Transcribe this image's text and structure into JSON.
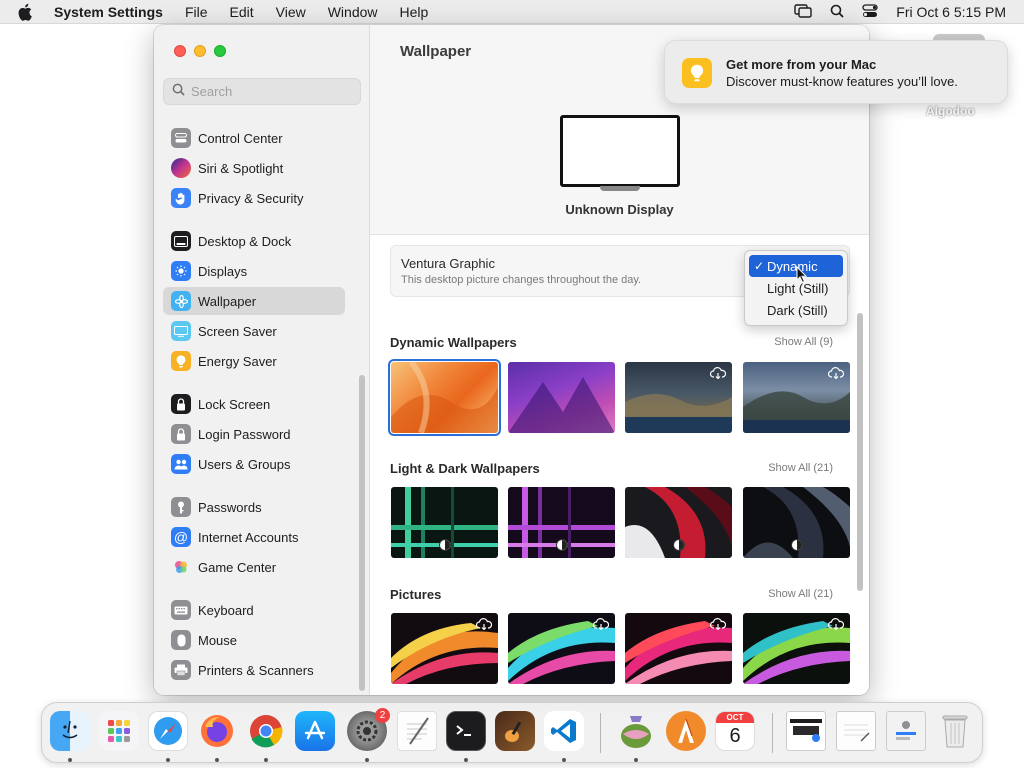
{
  "menubar": {
    "app_name": "System Settings",
    "menus": [
      "File",
      "Edit",
      "View",
      "Window",
      "Help"
    ],
    "clock": "Fri Oct 6  5:15 PM"
  },
  "desktop": {
    "icon_label": "Algodoo"
  },
  "sidebar": {
    "search_placeholder": "Search",
    "items": [
      {
        "label": "Control Center",
        "icon": "control-center-icon",
        "color": "#8e8e93"
      },
      {
        "label": "Siri & Spotlight",
        "icon": "siri-icon",
        "color": "#b03c8e"
      },
      {
        "label": "Privacy & Security",
        "icon": "hand-icon",
        "color": "#3a82f7"
      },
      {
        "label": "Desktop & Dock",
        "icon": "dock-icon",
        "color": "#1d1d1f"
      },
      {
        "label": "Displays",
        "icon": "sun-icon",
        "color": "#2f7ef6"
      },
      {
        "label": "Wallpaper",
        "icon": "flower-icon",
        "color": "#43b2f0"
      },
      {
        "label": "Screen Saver",
        "icon": "screen-saver-icon",
        "color": "#5ac8f0"
      },
      {
        "label": "Energy Saver",
        "icon": "bulb-icon",
        "color": "#f7b125"
      },
      {
        "label": "Lock Screen",
        "icon": "lock-icon",
        "color": "#1d1d1f"
      },
      {
        "label": "Login Password",
        "icon": "lock-icon",
        "color": "#8e8e93"
      },
      {
        "label": "Users & Groups",
        "icon": "users-icon",
        "color": "#2f7ef6"
      },
      {
        "label": "Passwords",
        "icon": "key-icon",
        "color": "#8e8e93"
      },
      {
        "label": "Internet Accounts",
        "icon": "at-icon",
        "color": "#2f7ef6"
      },
      {
        "label": "Game Center",
        "icon": "game-center-icon",
        "color": "#ffffff"
      },
      {
        "label": "Keyboard",
        "icon": "keyboard-icon",
        "color": "#8e8e93"
      },
      {
        "label": "Mouse",
        "icon": "mouse-icon",
        "color": "#8e8e93"
      },
      {
        "label": "Printers & Scanners",
        "icon": "printer-icon",
        "color": "#8e8e93"
      }
    ],
    "selected": "Wallpaper"
  },
  "main": {
    "title": "Wallpaper",
    "display_label": "Unknown Display",
    "current_wallpaper": {
      "name": "Ventura Graphic",
      "description": "This desktop picture changes throughout the day."
    },
    "appearance_options": [
      "Dynamic",
      "Light (Still)",
      "Dark (Still)"
    ],
    "appearance_selected": "Dynamic",
    "sections": [
      {
        "title": "Dynamic Wallpapers",
        "show_all": "Show All (9)"
      },
      {
        "title": "Light & Dark Wallpapers",
        "show_all": "Show All (21)"
      },
      {
        "title": "Pictures",
        "show_all": "Show All (21)"
      }
    ]
  },
  "notification": {
    "title": "Get more from your Mac",
    "body": "Discover must-know features you’ll love."
  },
  "dock": {
    "apps": [
      "Finder",
      "Launchpad",
      "Safari",
      "Firefox",
      "Chrome",
      "App Store",
      "System Settings",
      "TextEdit",
      "Terminal",
      "GarageBand",
      "Visual Studio Code",
      "Preview",
      "Algodoo",
      "Calendar"
    ],
    "settings_badge": "2",
    "calendar_month": "OCT",
    "calendar_day": "6"
  }
}
